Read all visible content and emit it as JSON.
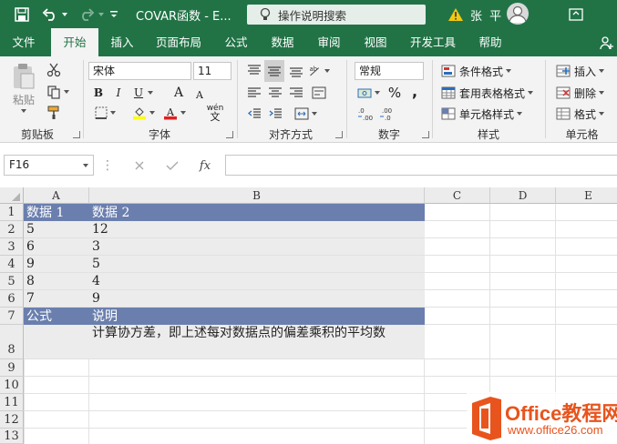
{
  "titlebar": {
    "doc_title": "COVAR函数  -  E...",
    "search_placeholder": "操作说明搜索",
    "user_name": "张 平"
  },
  "tabs": [
    {
      "label": "文件",
      "active": false
    },
    {
      "label": "开始",
      "active": true
    },
    {
      "label": "插入",
      "active": false
    },
    {
      "label": "页面布局",
      "active": false
    },
    {
      "label": "公式",
      "active": false
    },
    {
      "label": "数据",
      "active": false
    },
    {
      "label": "审阅",
      "active": false
    },
    {
      "label": "视图",
      "active": false
    },
    {
      "label": "开发工具",
      "active": false
    },
    {
      "label": "帮助",
      "active": false
    }
  ],
  "ribbon": {
    "clipboard": {
      "paste_label": "粘贴",
      "group_label": "剪贴板"
    },
    "font": {
      "font_name": "宋体",
      "font_size": "11",
      "group_label": "字体",
      "bold": "B",
      "italic": "I",
      "underline": "U",
      "grow": "A",
      "shrink": "A",
      "phonetic": "wén"
    },
    "alignment": {
      "group_label": "对齐方式"
    },
    "number": {
      "format": "常规",
      "group_label": "数字",
      "percent": "%",
      "comma": ","
    },
    "styles": {
      "conditional": "条件格式",
      "table": "套用表格格式",
      "cell": "单元格样式",
      "group_label": "样式"
    },
    "cells": {
      "insert": "插入",
      "delete": "删除",
      "format": "格式",
      "group_label": "单元格"
    }
  },
  "formula_bar": {
    "name_box": "F16",
    "formula": "",
    "fx": "fx"
  },
  "grid": {
    "columns": [
      "A",
      "B",
      "C",
      "D",
      "E"
    ],
    "rows": [
      "1",
      "2",
      "3",
      "4",
      "5",
      "6",
      "7",
      "8",
      "9",
      "10",
      "11",
      "12",
      "13"
    ],
    "cells": {
      "A1": "数据 1",
      "B1": "数据 2",
      "A2": "5",
      "B2": "12",
      "A3": "6",
      "B3": "3",
      "A4": "9",
      "B4": "5",
      "A5": "8",
      "B5": "4",
      "A6": "7",
      "B6": "9",
      "A7": "公式",
      "B7": "说明",
      "B8": "计算协方差，即上述每对数据点的偏差乘积的平均数"
    }
  },
  "watermark": {
    "brand": "Office教程网",
    "url": "www.office26.com"
  },
  "colors": {
    "brand_green": "#217346",
    "header_fill": "#6b7fae",
    "shade_fill": "#ececec",
    "watermark_orange": "#e8541d"
  }
}
